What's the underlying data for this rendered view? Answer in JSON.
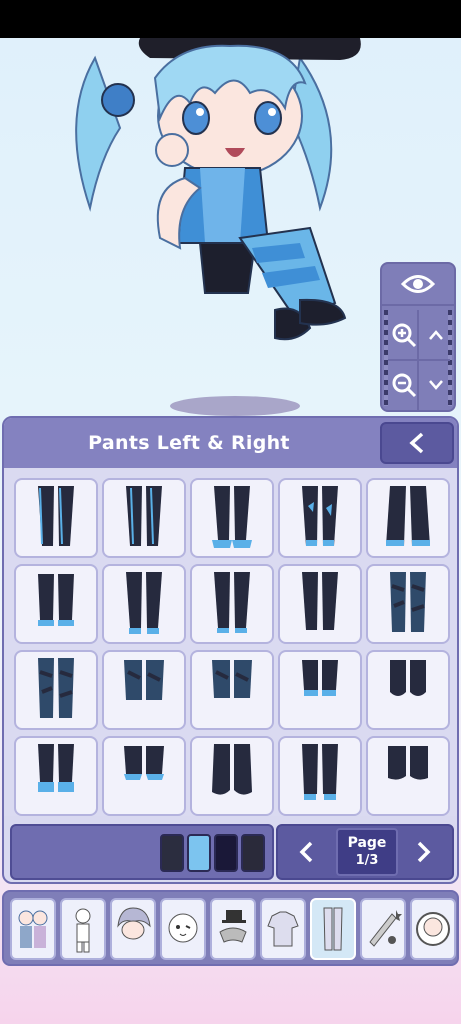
{
  "panel": {
    "title": "Pants Left & Right"
  },
  "pager": {
    "page_label": "Page",
    "page_value": "1/3"
  },
  "icons": {
    "back": "chevron-left-icon",
    "prev": "chevron-left-icon",
    "next": "chevron-right-icon",
    "eye": "eye-icon",
    "zoom_in": "zoom-in-icon",
    "zoom_out": "zoom-out-icon",
    "up": "chevron-up-icon",
    "down": "chevron-down-icon"
  },
  "swatches": [
    "#2b2d3f",
    "#7cc4ef",
    "#1a1838",
    "#2a2a3a"
  ],
  "categories": [
    "preset",
    "body",
    "hair",
    "face",
    "accessory",
    "top",
    "bottom",
    "items",
    "profile"
  ],
  "selected_category": "bottom",
  "colors": {
    "accent": "#8482c0",
    "dark": "#5c5aa0",
    "pants": "#262a3e",
    "trim": "#5ab0e8"
  }
}
